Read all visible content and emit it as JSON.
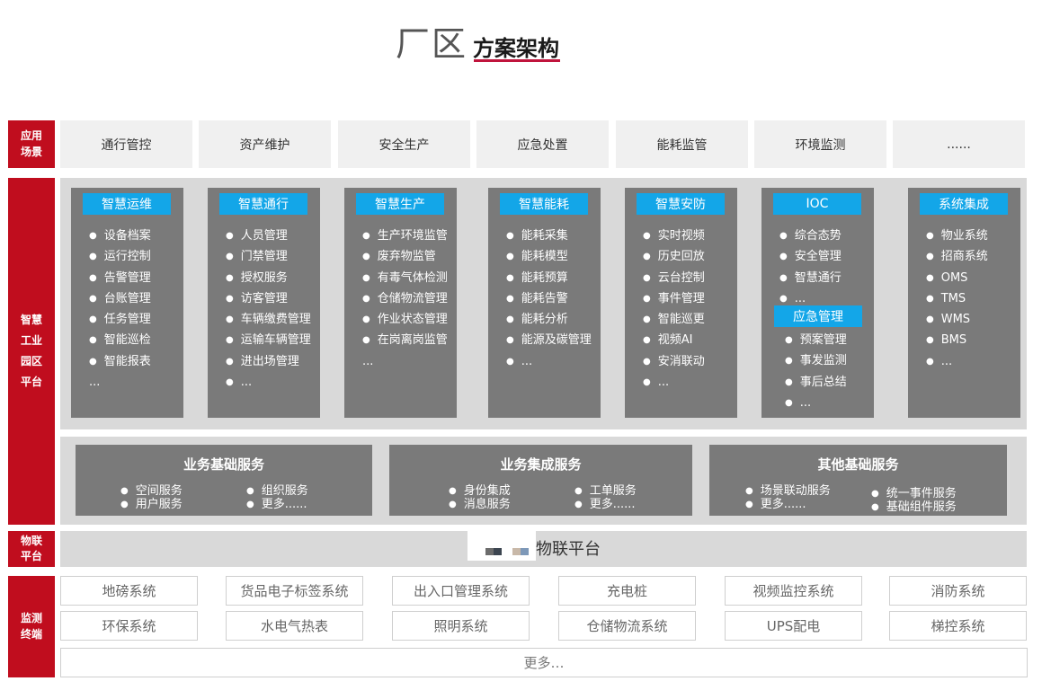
{
  "title": {
    "prefix": "厂区",
    "main": "方案架构"
  },
  "side_labels": {
    "app": "应用场景",
    "platform": "智慧工业园区平台",
    "iot": "物联平台",
    "terminal": "监测终端"
  },
  "scenes": [
    "通行管控",
    "资产维护",
    "安全生产",
    "应急处置",
    "能耗监管",
    "环境监测",
    "......"
  ],
  "cards": [
    {
      "title": "智慧运维",
      "items": [
        "设备档案",
        "运行控制",
        "告警管理",
        "台账管理",
        "任务管理",
        "智能巡检",
        "智能报表"
      ],
      "more": "..."
    },
    {
      "title": "智慧通行",
      "items": [
        "人员管理",
        "门禁管理",
        "授权服务",
        "访客管理",
        "车辆缴费管理",
        "运输车辆管理",
        "进出场管理",
        "..."
      ]
    },
    {
      "title": "智慧生产",
      "items": [
        "生产环境监管",
        "废弃物监管",
        "有毒气体检测",
        "仓储物流管理",
        "作业状态管理",
        "在岗离岗监管"
      ],
      "more": "..."
    },
    {
      "title": "智慧能耗",
      "items": [
        "能耗采集",
        "能耗模型",
        "能耗预算",
        "能耗告警",
        "能耗分析",
        "能源及碳管理",
        "..."
      ]
    },
    {
      "title": "智慧安防",
      "items": [
        "实时视频",
        "历史回放",
        "云台控制",
        "事件管理",
        "智能巡更",
        "视频AI",
        "安消联动",
        "..."
      ]
    },
    {
      "title": "IOC",
      "items": [
        "综合态势",
        "安全管理",
        "智慧通行",
        "..."
      ],
      "sub_title": "应急管理",
      "sub_items": [
        "预案管理",
        "事发监测",
        "事后总结",
        "..."
      ]
    },
    {
      "title": "系统集成",
      "items": [
        "物业系统",
        "招商系统",
        "OMS",
        "TMS",
        "WMS",
        "BMS",
        "..."
      ]
    }
  ],
  "services": [
    {
      "title": "业务基础服务",
      "col1": [
        "空间服务",
        "用户服务"
      ],
      "col2": [
        "组织服务",
        "更多......"
      ]
    },
    {
      "title": "业务集成服务",
      "col1": [
        "身份集成",
        "消息服务"
      ],
      "col2": [
        "工单服务",
        "更多......"
      ]
    },
    {
      "title": "其他基础服务",
      "col1": [
        "场景联动服务",
        "更多......"
      ],
      "col2": [
        "统一事件服务",
        "基础组件服务"
      ]
    }
  ],
  "iot_platform": "物联平台",
  "terminals_row1": [
    "地磅系统",
    "货品电子标签系统",
    "出入口管理系统",
    "充电桩",
    "视频监控系统",
    "消防系统"
  ],
  "terminals_row2": [
    "环保系统",
    "水电气热表",
    "照明系统",
    "仓储物流系统",
    "UPS配电",
    "梯控系统"
  ],
  "terminals_more": "更多…",
  "colors": {
    "brand_red": "#c00d1e",
    "title_underline": "#c0143c",
    "header_blue": "#13a6e8",
    "card_gray": "#7a7a7a",
    "panel_gray": "#d9d9d9"
  }
}
